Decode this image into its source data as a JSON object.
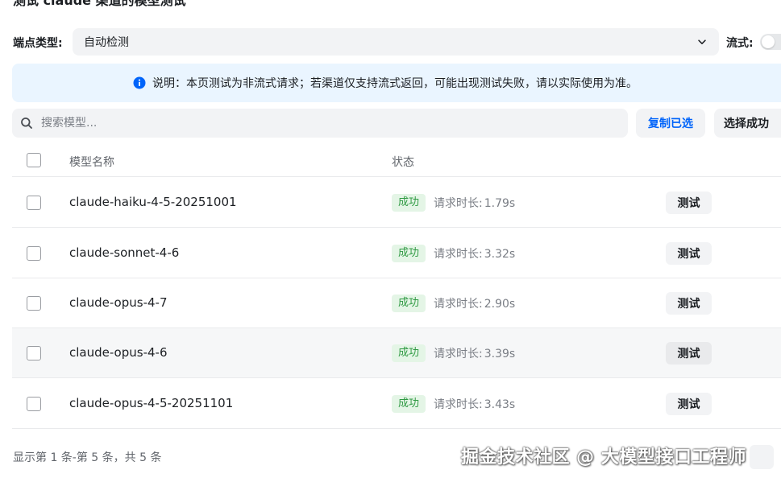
{
  "header": {
    "title_partial": "测试 claude 渠道的模型测试"
  },
  "endpoint": {
    "label": "端点类型:",
    "value": "自动检测",
    "stream_label": "流式:",
    "stream_on": false
  },
  "notice": {
    "text": "说明：本页测试为非流式请求；若渠道仅支持流式返回，可能出现测试失败，请以实际使用为准。"
  },
  "search": {
    "placeholder": "搜索模型..."
  },
  "actions": {
    "copy_selected": "复制已选",
    "select_success": "选择成功"
  },
  "table": {
    "columns": [
      "模型名称",
      "状态"
    ],
    "duration_label": "请求时长:",
    "test_label": "测试",
    "rows": [
      {
        "model": "claude-haiku-4-5-20251001",
        "status": "成功",
        "duration": "1.79s"
      },
      {
        "model": "claude-sonnet-4-6",
        "status": "成功",
        "duration": "3.32s"
      },
      {
        "model": "claude-opus-4-7",
        "status": "成功",
        "duration": "2.90s"
      },
      {
        "model": "claude-opus-4-6",
        "status": "成功",
        "duration": "3.39s"
      },
      {
        "model": "claude-opus-4-5-20251101",
        "status": "成功",
        "duration": "3.43s"
      }
    ]
  },
  "footer": {
    "summary": "显示第 1 条-第 5 条，共 5 条"
  },
  "watermark": {
    "text": "掘金技术社区 @ 大模型接口工程师"
  },
  "colors": {
    "accent": "#0064fa",
    "success_text": "#2f9a43",
    "success_bg": "#e4f5e6",
    "notice_bg": "#eaf5ff"
  }
}
